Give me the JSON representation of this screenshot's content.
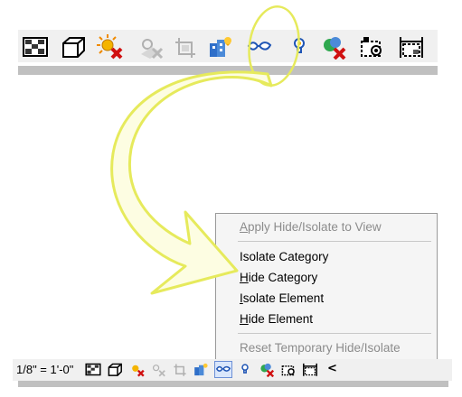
{
  "toolbar_top": {
    "icons": [
      "visual-style-icon",
      "3d-view-icon",
      "sun-path-off-icon",
      "shadows-off-icon",
      "crop-region-icon",
      "render-icon",
      "temporary-hide-isolate-icon",
      "reveal-hidden-elements-icon",
      "analysis-off-icon",
      "lock-3d-view-icon",
      "temporary-view-properties-icon"
    ]
  },
  "context_menu": {
    "apply": {
      "first": "A",
      "rest": "pply Hide/Isolate to View"
    },
    "isolate_category": {
      "first": "I",
      "rest": "solate Category"
    },
    "hide_category": {
      "first": "H",
      "rest": "ide Category"
    },
    "isolate_element": {
      "first": "I",
      "rest": "solate Element"
    },
    "hide_element": {
      "first": "H",
      "rest": "ide Element"
    },
    "reset": {
      "first": "R",
      "rest": "eset Temporary Hide/Isolate"
    }
  },
  "view_bar": {
    "scale": "1/8\" = 1'-0\"",
    "expand_glyph": "<"
  },
  "colors": {
    "annotation": "#e6ea5c",
    "menu_bg": "#f5f5f5",
    "toolbar_bg": "#f0f0f0"
  }
}
